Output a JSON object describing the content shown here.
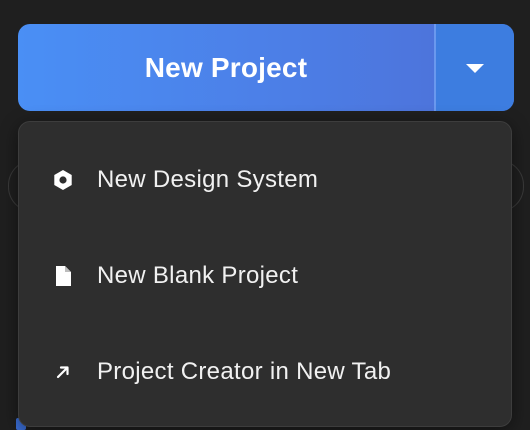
{
  "primary_button": {
    "label": "New Project"
  },
  "dropdown_toggle": {
    "icon": "caret-down-icon"
  },
  "menu": {
    "items": [
      {
        "label": "New Design System",
        "icon": "hexagon-icon"
      },
      {
        "label": "New Blank Project",
        "icon": "file-icon"
      },
      {
        "label": "Project Creator in New Tab",
        "icon": "external-arrow-icon"
      }
    ]
  },
  "colors": {
    "button_gradient_start": "#4a8ff5",
    "button_gradient_end": "#4e6fd6",
    "menu_background": "#2e2e2e",
    "page_background": "#1f1f1f",
    "text": "#f1f1f1"
  }
}
